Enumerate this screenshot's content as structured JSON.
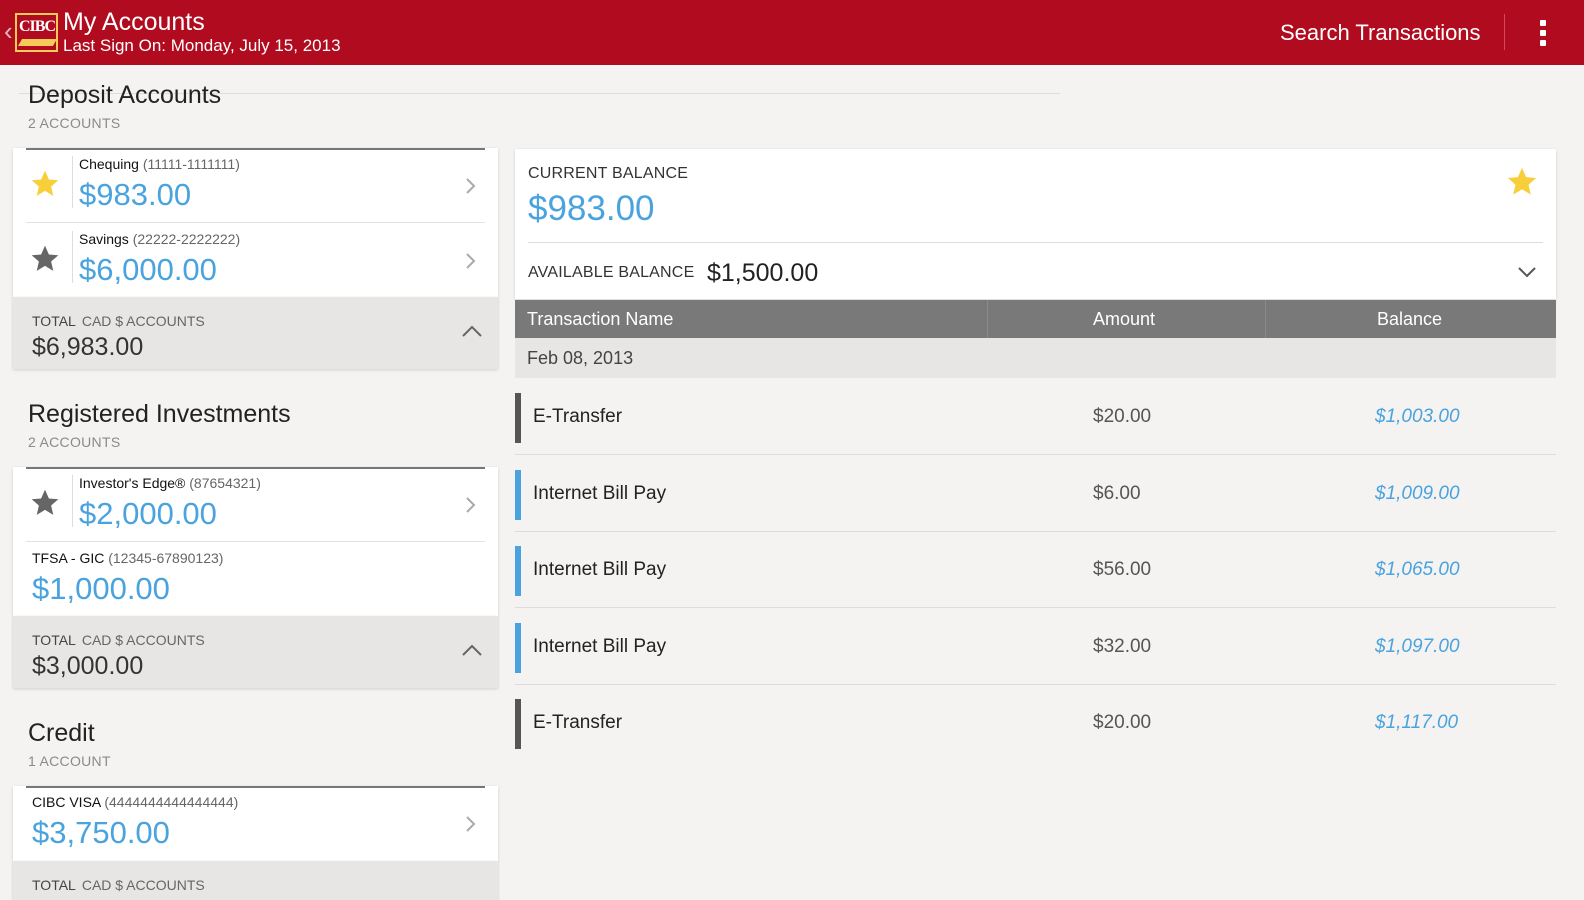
{
  "header": {
    "title": "My Accounts",
    "subtitle": "Last Sign On: Monday, July 15, 2013",
    "search_label": "Search Transactions",
    "logo_text": "CIBC"
  },
  "deposit": {
    "title": "Deposit Accounts",
    "count": "2 ACCOUNTS",
    "accounts": [
      {
        "name": "Chequing",
        "number": "(11111-1111111)",
        "amount": "$983.00",
        "favorite": true
      },
      {
        "name": "Savings",
        "number": "(22222-2222222)",
        "amount": "$6,000.00",
        "favorite": false
      }
    ],
    "total_label": "TOTAL",
    "total_sub": "CAD $ ACCOUNTS",
    "total_value": "$6,983.00"
  },
  "registered": {
    "title": "Registered Investments",
    "count": "2 ACCOUNTS",
    "accounts": [
      {
        "name": "Investor's Edge®",
        "number": "(87654321)",
        "amount": "$2,000.00",
        "favorite": false
      },
      {
        "name": "TFSA - GIC",
        "number": "(12345-67890123)",
        "amount": "$1,000.00"
      }
    ],
    "total_label": "TOTAL",
    "total_sub": "CAD $ ACCOUNTS",
    "total_value": "$3,000.00"
  },
  "credit": {
    "title": "Credit",
    "count": "1 ACCOUNT",
    "accounts": [
      {
        "name": "CIBC VISA",
        "number": "(4444444444444444)",
        "amount": "$3,750.00"
      }
    ],
    "total_label": "TOTAL",
    "total_sub": "CAD $ ACCOUNTS"
  },
  "detail": {
    "current_label": "CURRENT BALANCE",
    "current_value": "$983.00",
    "available_label": "AVAILABLE BALANCE",
    "available_value": "$1,500.00"
  },
  "table": {
    "columns": [
      "Transaction Name",
      "Amount",
      "Balance"
    ],
    "date": "Feb 08, 2013",
    "rows": [
      {
        "name": "E-Transfer",
        "amount": "$20.00",
        "balance": "$1,003.00",
        "kind": "transfer"
      },
      {
        "name": "Internet Bill Pay",
        "amount": "$6.00",
        "balance": "$1,009.00",
        "kind": "billpay"
      },
      {
        "name": "Internet Bill Pay",
        "amount": "$56.00",
        "balance": "$1,065.00",
        "kind": "billpay"
      },
      {
        "name": "Internet Bill Pay",
        "amount": "$32.00",
        "balance": "$1,097.00",
        "kind": "billpay"
      },
      {
        "name": "E-Transfer",
        "amount": "$20.00",
        "balance": "$1,117.00",
        "kind": "transfer"
      }
    ]
  },
  "colors": {
    "brand_red": "#b00b1e",
    "amount_blue": "#4aa3df",
    "favorite_gold": "#f7cf3b",
    "star_gray": "#666666",
    "transfer_bar": "#555555",
    "billpay_bar": "#4aa3df"
  }
}
